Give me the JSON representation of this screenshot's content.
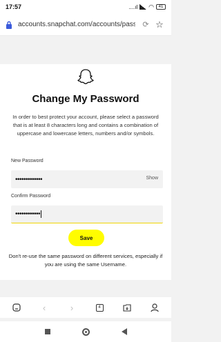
{
  "status_bar": {
    "time": "17:57",
    "status_text": "....ıl",
    "battery": "41"
  },
  "browser": {
    "url": "accounts.snapchat.com/accounts/passw",
    "tabs_count": "4"
  },
  "page": {
    "title": "Change My Password",
    "description": "In order to best protect your account, please select a password that is at least 8 characters long and contains a combination of uppercase and lowercase letters, numbers and/or symbols.",
    "new_password": {
      "label": "New Password",
      "value": "•••••••••••••",
      "show_label": "Show"
    },
    "confirm_password": {
      "label": "Confirm Password",
      "value": "••••••••••••"
    },
    "save_label": "Save",
    "note": "Don't re-use the same password on different services, especially if you are using the same Username."
  },
  "colors": {
    "brand_yellow": "#fffc00",
    "focus_underline": "#f0d400"
  }
}
